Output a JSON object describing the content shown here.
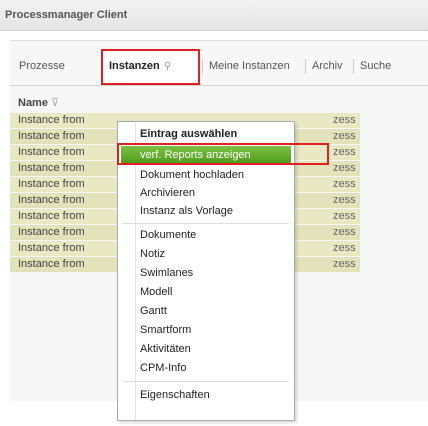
{
  "window": {
    "title": "Processmanager Client"
  },
  "tabs": [
    {
      "label": "Prozesse"
    },
    {
      "label": "Instanzen"
    },
    {
      "label": "Meine Instanzen"
    },
    {
      "label": "Archiv"
    },
    {
      "label": "Suche"
    }
  ],
  "table": {
    "column_header": "Name",
    "rows": [
      {
        "name": "Instance from",
        "tail": "zess"
      },
      {
        "name": "Instance from",
        "tail": "zess"
      },
      {
        "name": "Instance from",
        "tail": "zess"
      },
      {
        "name": "Instance from",
        "tail": "zess"
      },
      {
        "name": "Instance from",
        "tail": "zess"
      },
      {
        "name": "Instance from",
        "tail": "zess"
      },
      {
        "name": "Instance from",
        "tail": "zess"
      },
      {
        "name": "Instance from",
        "tail": "zess"
      },
      {
        "name": "Instance from",
        "tail": "zess"
      },
      {
        "name": "Instance from",
        "tail": "zess"
      }
    ]
  },
  "context_menu": {
    "items": [
      {
        "label": "Eintrag auswählen"
      },
      {
        "label": "verf. Reports anzeigen"
      },
      {
        "label": "Dokument hochladen"
      },
      {
        "label": "Archivieren"
      },
      {
        "label": "Instanz als Vorlage"
      },
      {
        "label": "Dokumente"
      },
      {
        "label": "Notiz"
      },
      {
        "label": "Swimlanes"
      },
      {
        "label": "Modell"
      },
      {
        "label": "Gantt"
      },
      {
        "label": "Smartform"
      },
      {
        "label": "Aktivitäten"
      },
      {
        "label": "CPM-Info"
      },
      {
        "label": "Eigenschaften"
      }
    ]
  },
  "colors": {
    "highlight": "#6aaa2e",
    "annotation": "#e02020",
    "row_bg": "#e8e9c3"
  }
}
